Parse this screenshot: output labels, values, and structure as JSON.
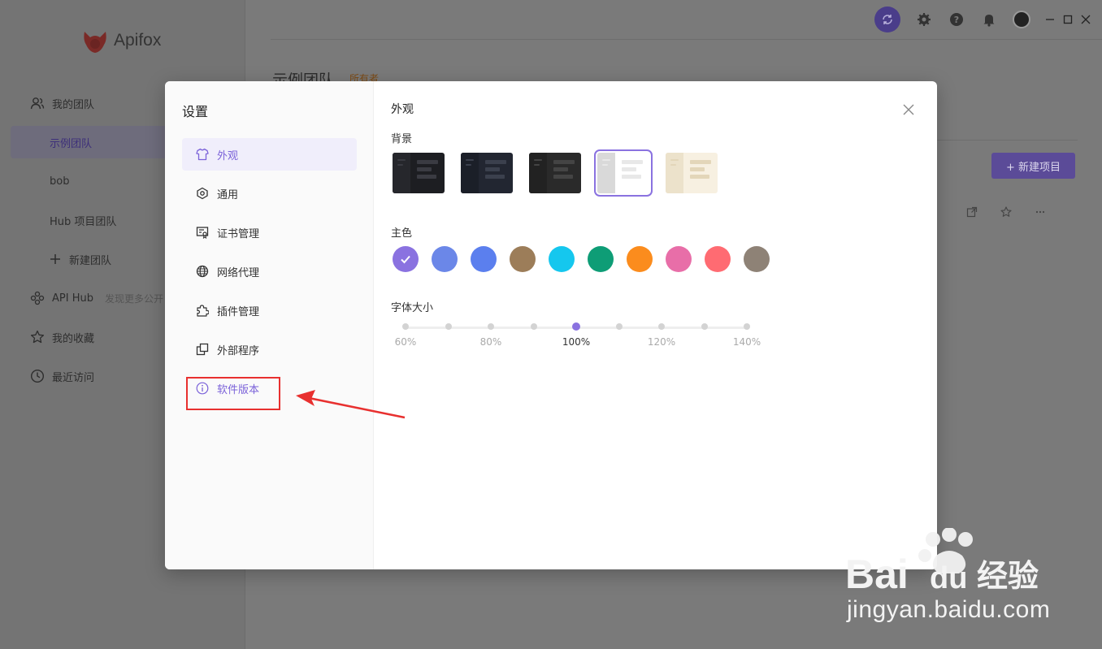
{
  "app": {
    "logo_text": "Apifox",
    "sidebar": {
      "items": [
        {
          "label": "我的团队",
          "icon": "team-icon"
        },
        {
          "label": "示例团队",
          "active": true
        },
        {
          "label": "bob"
        },
        {
          "label": "Hub 项目团队"
        },
        {
          "label": "新建团队",
          "icon": "plus-icon"
        },
        {
          "label": "API Hub",
          "hint": "发现更多公开",
          "icon": "api-hub-icon"
        },
        {
          "label": "我的收藏",
          "icon": "star-icon"
        },
        {
          "label": "最近访问",
          "icon": "clock-icon"
        }
      ]
    },
    "main": {
      "team_title": "示例团队",
      "owner_badge": "所有者",
      "new_project_label": "+ 新建项目"
    },
    "colors": {
      "brand": "#e0463f",
      "accent": "#7b62d9"
    }
  },
  "settings": {
    "title": "设置",
    "menu": [
      {
        "label": "外观",
        "icon": "shirt-icon",
        "active": true
      },
      {
        "label": "通用",
        "icon": "general-settings-icon"
      },
      {
        "label": "证书管理",
        "icon": "certificate-icon"
      },
      {
        "label": "网络代理",
        "icon": "globe-icon"
      },
      {
        "label": "插件管理",
        "icon": "puzzle-icon"
      },
      {
        "label": "外部程序",
        "icon": "external-program-icon"
      },
      {
        "label": "软件版本",
        "icon": "info-icon",
        "highlighted": true
      }
    ],
    "appearance": {
      "section_title": "外观",
      "background_label": "背景",
      "themes": [
        {
          "name": "dark-1",
          "bg": "#1d1e22",
          "side": "#26272c",
          "line": "#3a3b42"
        },
        {
          "name": "dark-2",
          "bg": "#222631",
          "side": "#1b1f28",
          "line": "#3b404d"
        },
        {
          "name": "dark-3",
          "bg": "#2a2a2a",
          "side": "#222222",
          "line": "#444444"
        },
        {
          "name": "light",
          "bg": "#ffffff",
          "side": "#d9d9d9",
          "line": "#e8e8e8",
          "selected": true
        },
        {
          "name": "sepia",
          "bg": "#f7f0e1",
          "side": "#ece2cb",
          "line": "#e3d6b9"
        }
      ],
      "primary_color_label": "主色",
      "primary_colors": [
        "#8a72e0",
        "#6b87e8",
        "#5b7fee",
        "#9c7d59",
        "#15c7ee",
        "#0e9d76",
        "#fb8c1d",
        "#e86ea8",
        "#ff6b72",
        "#8e8276"
      ],
      "selected_color_index": 0,
      "font_size_label": "字体大小",
      "font_size_ticks": [
        "60%",
        "",
        "80%",
        "",
        "100%",
        "",
        "120%",
        "",
        "140%"
      ],
      "font_size_selected_index": 4
    }
  },
  "watermark": {
    "brand": "Baidu经验",
    "url": "jingyan.baidu.com"
  }
}
